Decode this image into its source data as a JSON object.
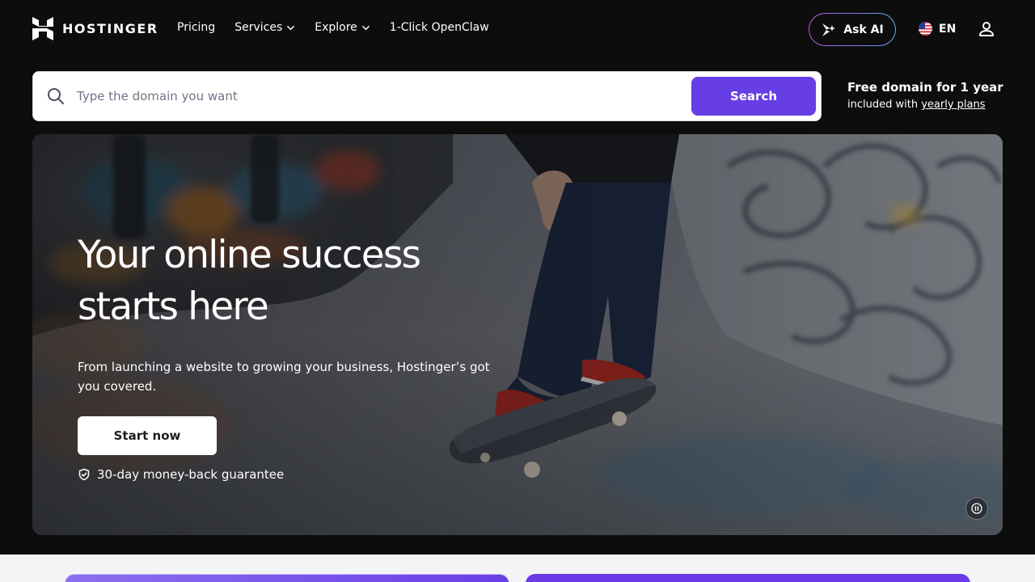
{
  "brand": {
    "name": "HOSTINGER"
  },
  "nav": {
    "items": [
      {
        "label": "Pricing",
        "has_dropdown": false
      },
      {
        "label": "Services",
        "has_dropdown": true
      },
      {
        "label": "Explore",
        "has_dropdown": true
      },
      {
        "label": "1-Click OpenClaw",
        "has_dropdown": false
      }
    ],
    "ask_ai_label": "Ask AI",
    "language_label": "EN"
  },
  "domain_search": {
    "placeholder": "Type the domain you want",
    "button_label": "Search",
    "promo_title": "Free domain for 1 year",
    "promo_prefix": "included with ",
    "promo_link": "yearly plans"
  },
  "hero": {
    "title_line1": "Your online success",
    "title_line2": "starts here",
    "description": "From launching a website to growing your business, Hostinger’s got you covered.",
    "cta_label": "Start now",
    "guarantee": "30-day money-back guarantee"
  },
  "colors": {
    "accent": "#673de6",
    "background": "#0d0d0e",
    "card_light": "#8c6ff0",
    "card_dark": "#6a3ae6"
  },
  "icons": {
    "logo": "hostinger-logo-icon",
    "search": "search-icon",
    "ask_ai": "sparkle-icon",
    "flag": "us-flag-icon",
    "user": "user-icon",
    "guarantee": "shield-check-icon",
    "pause": "pause-icon",
    "chevron": "chevron-down-icon"
  }
}
